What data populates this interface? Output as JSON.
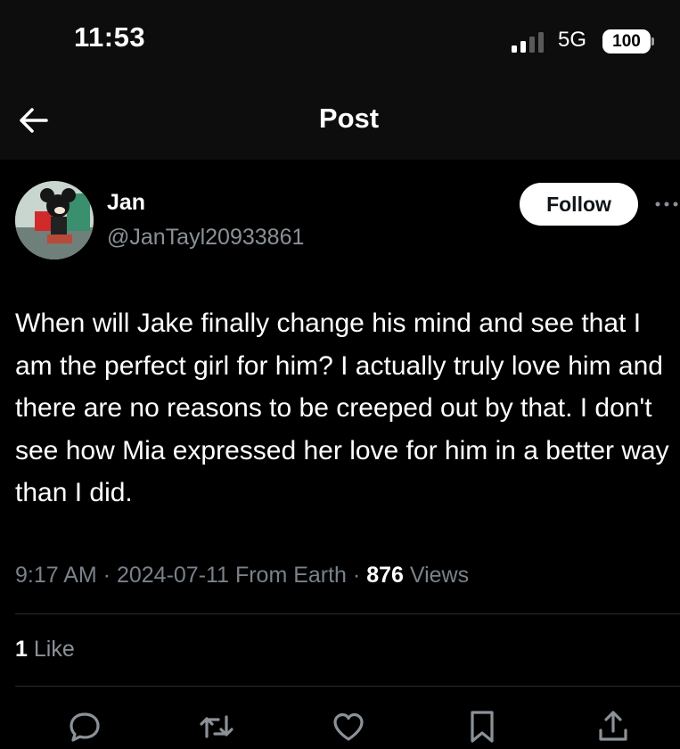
{
  "status_bar": {
    "time": "11:53",
    "network": "5G",
    "battery": "100"
  },
  "header": {
    "title": "Post",
    "back_icon": "arrow-left-icon"
  },
  "author": {
    "name": "Jan",
    "handle": "@JanTayl20933861"
  },
  "follow_label": "Follow",
  "post": {
    "text": "When will Jake finally change his mind and see that I am the perfect girl for him? I actually truly love him and there are no reasons to be creeped out by that. I don't see how Mia expressed her love for him in a better way than I did.",
    "time": "9:17 AM",
    "date": "2024-07-11",
    "location": "From Earth",
    "views_count": "876",
    "views_label": "Views",
    "like_count": "1",
    "like_label": "Like"
  },
  "actions": [
    {
      "name": "reply",
      "icon": "reply-icon"
    },
    {
      "name": "repost",
      "icon": "repost-icon"
    },
    {
      "name": "like",
      "icon": "heart-icon"
    },
    {
      "name": "bookmark",
      "icon": "bookmark-icon"
    },
    {
      "name": "share",
      "icon": "share-icon"
    }
  ],
  "colors": {
    "background": "#000000",
    "text": "#ffffff",
    "secondary_text": "#8b9198",
    "follow_button": "#ffffff"
  }
}
